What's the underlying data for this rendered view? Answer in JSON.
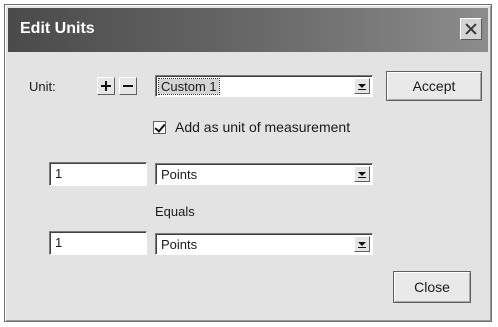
{
  "window": {
    "title": "Edit Units"
  },
  "unit": {
    "label": "Unit:",
    "selected": "Custom 1",
    "add_checkbox_label": "Add as unit of measurement",
    "add_checked": true
  },
  "conversion": {
    "from_value": "1",
    "from_unit": "Points",
    "equals_label": "Equals",
    "to_value": "1",
    "to_unit": "Points"
  },
  "buttons": {
    "accept": "Accept",
    "close": "Close"
  },
  "icons": {
    "close": "close-icon",
    "plus": "plus-icon",
    "minus": "minus-icon",
    "dropdown": "chevron-down-icon"
  }
}
